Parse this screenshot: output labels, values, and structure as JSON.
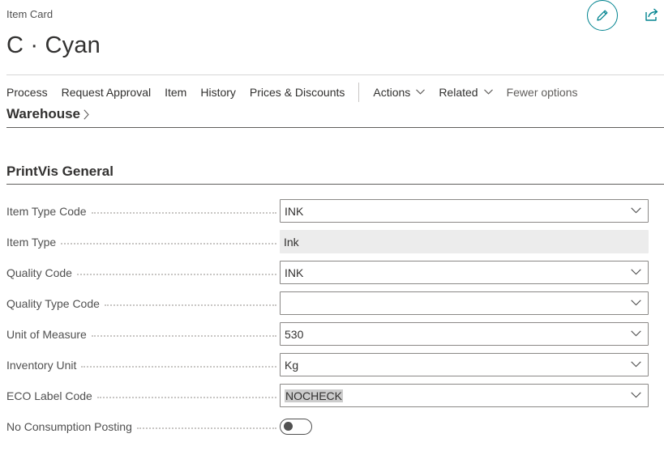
{
  "header": {
    "caption": "Item Card",
    "title": "C · Cyan",
    "edit_icon": "pencil-icon",
    "share_icon": "share-icon"
  },
  "action_bar": {
    "items": [
      "Process",
      "Request Approval",
      "Item",
      "History",
      "Prices & Discounts"
    ],
    "menus": [
      "Actions",
      "Related"
    ],
    "fewer_options": "Fewer options"
  },
  "warehouse": {
    "label": "Warehouse"
  },
  "section": {
    "title": "PrintVis General"
  },
  "fields": [
    {
      "label": "Item Type Code",
      "value": "INK",
      "type": "dropdown"
    },
    {
      "label": "Item Type",
      "value": "Ink",
      "type": "readonly"
    },
    {
      "label": "Quality Code",
      "value": "INK",
      "type": "dropdown"
    },
    {
      "label": "Quality Type Code",
      "value": "",
      "type": "dropdown"
    },
    {
      "label": "Unit of Measure",
      "value": "530",
      "type": "dropdown"
    },
    {
      "label": "Inventory Unit",
      "value": "Kg",
      "type": "dropdown"
    },
    {
      "label": "ECO Label Code",
      "value": "NOCHECK",
      "type": "dropdown",
      "selected": true
    },
    {
      "label": "No Consumption Posting",
      "value": "off",
      "type": "toggle"
    }
  ],
  "colors": {
    "accent": "#00838f",
    "text": "#323130",
    "readonly_bg": "#ececec"
  }
}
